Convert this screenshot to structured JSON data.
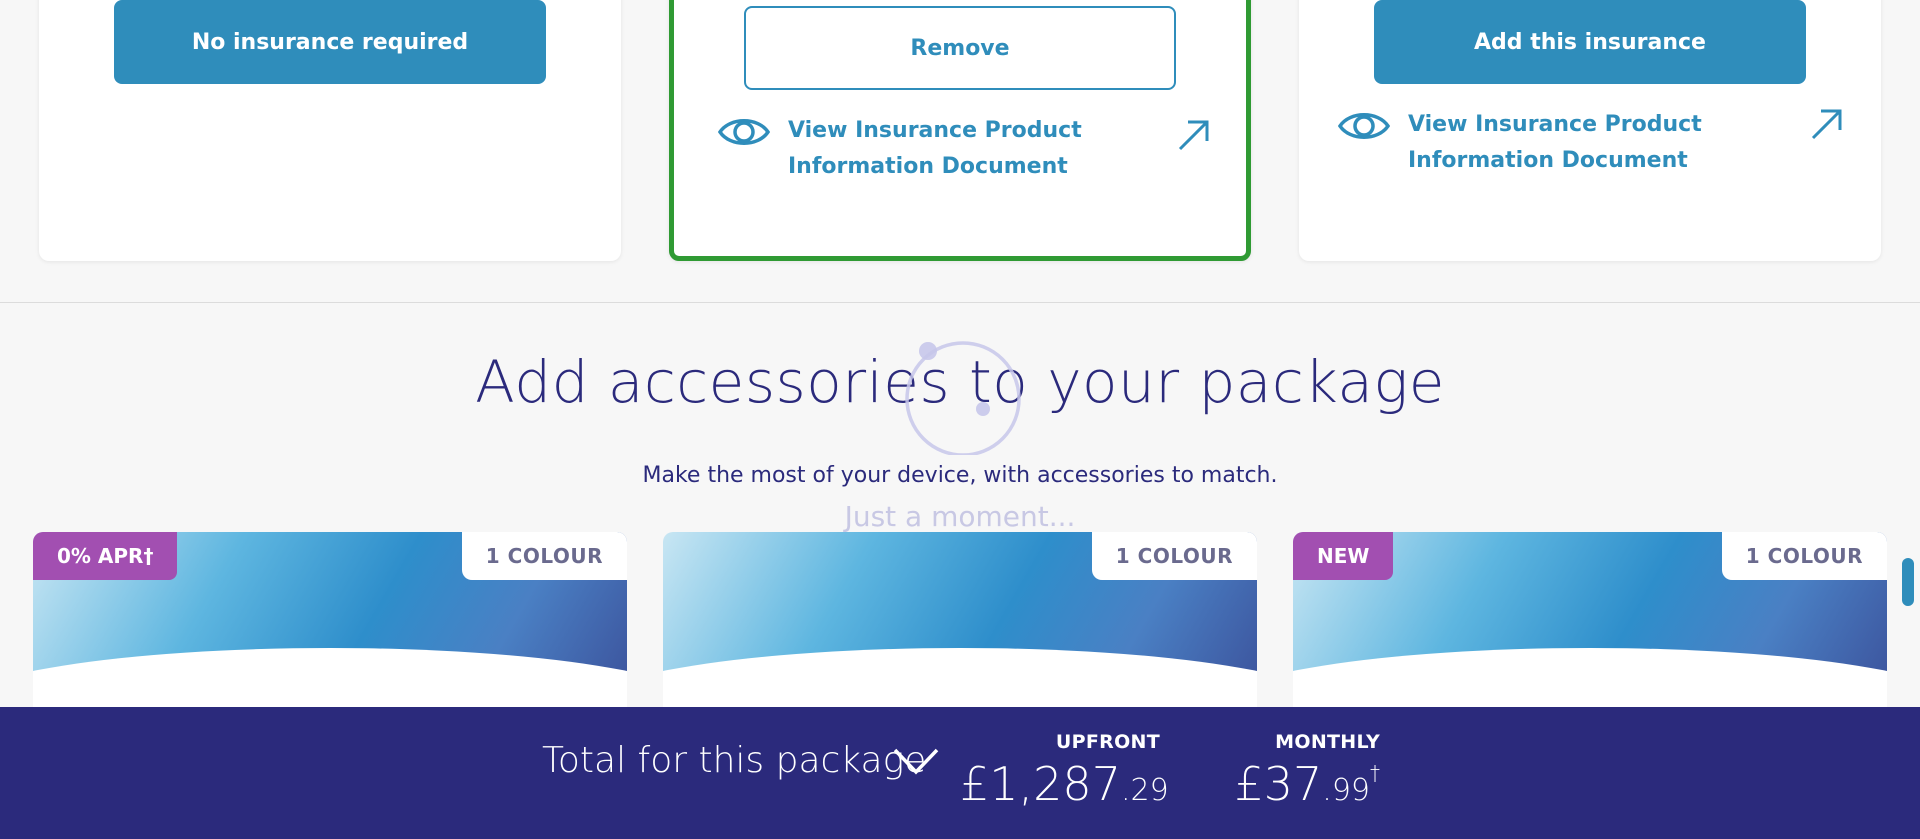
{
  "insurance": {
    "left_card": {
      "button_label": "No insurance required"
    },
    "mid_card": {
      "button_label": "Remove",
      "ipid_link_line1": "View Insurance Product",
      "ipid_link_line2": "Information Document"
    },
    "right_card": {
      "button_label": "Add this insurance",
      "ipid_link_line1": "View Insurance Product",
      "ipid_link_line2": "Information Document"
    },
    "colors": {
      "accent": "#2f8dbb",
      "selected_border": "#2f9a33"
    },
    "icons": [
      "eye-icon",
      "external-link-icon"
    ]
  },
  "accessories": {
    "title": "Add accessories to your package",
    "subtitle": "Make the most of your device, with accessories to match.",
    "loading_text": "Just a moment...",
    "cards": [
      {
        "promo_badge": "0% APR†",
        "colour_badge": "1 COLOUR"
      },
      {
        "promo_badge": "",
        "colour_badge": "1 COLOUR"
      },
      {
        "promo_badge": "NEW",
        "colour_badge": "1 COLOUR"
      }
    ],
    "colors": {
      "promo_badge": "#a24fb1"
    }
  },
  "total_bar": {
    "label": "Total for this package",
    "upfront": {
      "label": "UPFRONT",
      "pounds": "£1,287",
      "pence": ".29"
    },
    "monthly": {
      "label": "MONTHLY",
      "pounds": "£37",
      "pence": ".99",
      "marker": "†"
    },
    "colors": {
      "background": "#2b2a7c"
    }
  }
}
